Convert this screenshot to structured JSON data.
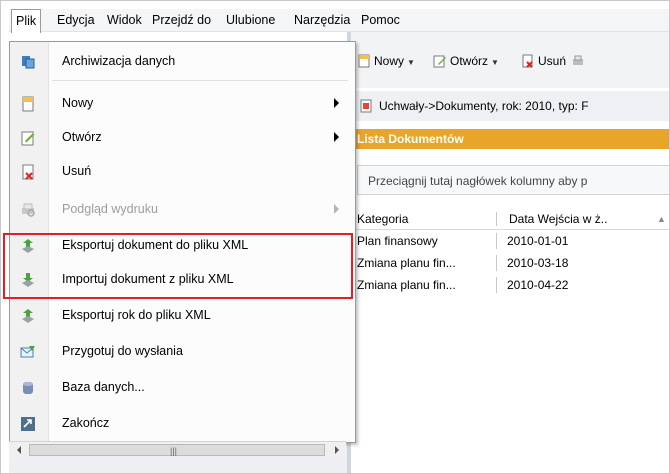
{
  "menubar": {
    "items": [
      {
        "label": "Plik"
      },
      {
        "label": "Edycja"
      },
      {
        "label": "Widok"
      },
      {
        "label": "Przejdź do"
      },
      {
        "label": "Ulubione"
      },
      {
        "label": "Narzędzia"
      },
      {
        "label": "Pomoc"
      }
    ],
    "active_index": 0
  },
  "toolbar": {
    "new_label": "Nowy",
    "open_label": "Otwórz",
    "delete_label": "Usuń"
  },
  "breadcrumb": {
    "text": "Uchwały->Dokumenty, rok: 2010, typ: F"
  },
  "grid": {
    "title": "Lista Dokumentów",
    "group_hint": "Przeciągnij tutaj nagłówek kolumny aby p",
    "columns": [
      "Kategoria",
      "Data Wejścia w ż.."
    ],
    "rows": [
      [
        "Plan finansowy",
        "2010-01-01"
      ],
      [
        "Zmiana planu fin...",
        "2010-03-18"
      ],
      [
        "Zmiana planu fin...",
        "2010-04-22"
      ]
    ]
  },
  "file_menu": {
    "items": [
      {
        "label": "Archiwizacja danych",
        "icon": "archive-icon",
        "submenu": false,
        "disabled": false
      },
      {
        "label": "Nowy",
        "icon": "new-document-icon",
        "submenu": true,
        "disabled": false
      },
      {
        "label": "Otwórz",
        "icon": "open-edit-icon",
        "submenu": true,
        "disabled": false
      },
      {
        "label": "Usuń",
        "icon": "delete-document-icon",
        "submenu": false,
        "disabled": false
      },
      {
        "label": "Podgląd wydruku",
        "icon": "print-preview-icon",
        "submenu": true,
        "disabled": true
      },
      {
        "label": "Eksportuj dokument do pliku XML",
        "icon": "export-xml-icon",
        "submenu": false,
        "disabled": false
      },
      {
        "label": "Importuj dokument z pliku XML",
        "icon": "import-xml-icon",
        "submenu": false,
        "disabled": false
      },
      {
        "label": "Eksportuj rok do pliku XML",
        "icon": "export-year-icon",
        "submenu": false,
        "disabled": false
      },
      {
        "label": "Przygotuj do wysłania",
        "icon": "send-prepare-icon",
        "submenu": false,
        "disabled": false
      },
      {
        "label": "Baza danych...",
        "icon": "database-icon",
        "submenu": false,
        "disabled": false
      },
      {
        "label": "Zakończ",
        "icon": "exit-icon",
        "submenu": false,
        "disabled": false
      }
    ]
  },
  "colors": {
    "highlight": "#e31e24",
    "grid_title_bg": "#e8a52a"
  }
}
